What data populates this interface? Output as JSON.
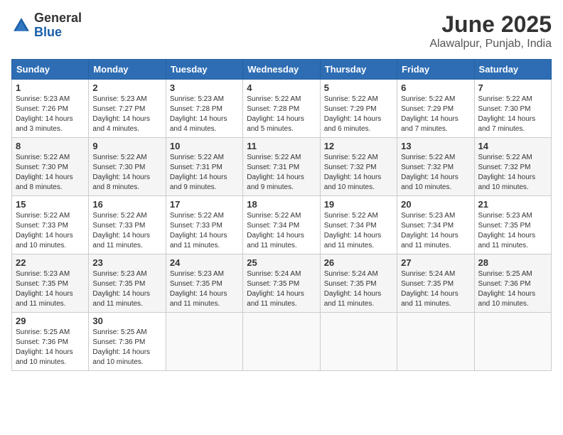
{
  "header": {
    "logo_general": "General",
    "logo_blue": "Blue",
    "month": "June 2025",
    "location": "Alawalpur, Punjab, India"
  },
  "days_of_week": [
    "Sunday",
    "Monday",
    "Tuesday",
    "Wednesday",
    "Thursday",
    "Friday",
    "Saturday"
  ],
  "weeks": [
    [
      {
        "day": "1",
        "sunrise": "5:23 AM",
        "sunset": "7:26 PM",
        "daylight": "14 hours and 3 minutes."
      },
      {
        "day": "2",
        "sunrise": "5:23 AM",
        "sunset": "7:27 PM",
        "daylight": "14 hours and 4 minutes."
      },
      {
        "day": "3",
        "sunrise": "5:23 AM",
        "sunset": "7:28 PM",
        "daylight": "14 hours and 4 minutes."
      },
      {
        "day": "4",
        "sunrise": "5:22 AM",
        "sunset": "7:28 PM",
        "daylight": "14 hours and 5 minutes."
      },
      {
        "day": "5",
        "sunrise": "5:22 AM",
        "sunset": "7:29 PM",
        "daylight": "14 hours and 6 minutes."
      },
      {
        "day": "6",
        "sunrise": "5:22 AM",
        "sunset": "7:29 PM",
        "daylight": "14 hours and 7 minutes."
      },
      {
        "day": "7",
        "sunrise": "5:22 AM",
        "sunset": "7:30 PM",
        "daylight": "14 hours and 7 minutes."
      }
    ],
    [
      {
        "day": "8",
        "sunrise": "5:22 AM",
        "sunset": "7:30 PM",
        "daylight": "14 hours and 8 minutes."
      },
      {
        "day": "9",
        "sunrise": "5:22 AM",
        "sunset": "7:30 PM",
        "daylight": "14 hours and 8 minutes."
      },
      {
        "day": "10",
        "sunrise": "5:22 AM",
        "sunset": "7:31 PM",
        "daylight": "14 hours and 9 minutes."
      },
      {
        "day": "11",
        "sunrise": "5:22 AM",
        "sunset": "7:31 PM",
        "daylight": "14 hours and 9 minutes."
      },
      {
        "day": "12",
        "sunrise": "5:22 AM",
        "sunset": "7:32 PM",
        "daylight": "14 hours and 10 minutes."
      },
      {
        "day": "13",
        "sunrise": "5:22 AM",
        "sunset": "7:32 PM",
        "daylight": "14 hours and 10 minutes."
      },
      {
        "day": "14",
        "sunrise": "5:22 AM",
        "sunset": "7:32 PM",
        "daylight": "14 hours and 10 minutes."
      }
    ],
    [
      {
        "day": "15",
        "sunrise": "5:22 AM",
        "sunset": "7:33 PM",
        "daylight": "14 hours and 10 minutes."
      },
      {
        "day": "16",
        "sunrise": "5:22 AM",
        "sunset": "7:33 PM",
        "daylight": "14 hours and 11 minutes."
      },
      {
        "day": "17",
        "sunrise": "5:22 AM",
        "sunset": "7:33 PM",
        "daylight": "14 hours and 11 minutes."
      },
      {
        "day": "18",
        "sunrise": "5:22 AM",
        "sunset": "7:34 PM",
        "daylight": "14 hours and 11 minutes."
      },
      {
        "day": "19",
        "sunrise": "5:22 AM",
        "sunset": "7:34 PM",
        "daylight": "14 hours and 11 minutes."
      },
      {
        "day": "20",
        "sunrise": "5:23 AM",
        "sunset": "7:34 PM",
        "daylight": "14 hours and 11 minutes."
      },
      {
        "day": "21",
        "sunrise": "5:23 AM",
        "sunset": "7:35 PM",
        "daylight": "14 hours and 11 minutes."
      }
    ],
    [
      {
        "day": "22",
        "sunrise": "5:23 AM",
        "sunset": "7:35 PM",
        "daylight": "14 hours and 11 minutes."
      },
      {
        "day": "23",
        "sunrise": "5:23 AM",
        "sunset": "7:35 PM",
        "daylight": "14 hours and 11 minutes."
      },
      {
        "day": "24",
        "sunrise": "5:23 AM",
        "sunset": "7:35 PM",
        "daylight": "14 hours and 11 minutes."
      },
      {
        "day": "25",
        "sunrise": "5:24 AM",
        "sunset": "7:35 PM",
        "daylight": "14 hours and 11 minutes."
      },
      {
        "day": "26",
        "sunrise": "5:24 AM",
        "sunset": "7:35 PM",
        "daylight": "14 hours and 11 minutes."
      },
      {
        "day": "27",
        "sunrise": "5:24 AM",
        "sunset": "7:35 PM",
        "daylight": "14 hours and 11 minutes."
      },
      {
        "day": "28",
        "sunrise": "5:25 AM",
        "sunset": "7:36 PM",
        "daylight": "14 hours and 10 minutes."
      }
    ],
    [
      {
        "day": "29",
        "sunrise": "5:25 AM",
        "sunset": "7:36 PM",
        "daylight": "14 hours and 10 minutes."
      },
      {
        "day": "30",
        "sunrise": "5:25 AM",
        "sunset": "7:36 PM",
        "daylight": "14 hours and 10 minutes."
      },
      null,
      null,
      null,
      null,
      null
    ]
  ],
  "labels": {
    "sunrise": "Sunrise:",
    "sunset": "Sunset:",
    "daylight": "Daylight:"
  }
}
